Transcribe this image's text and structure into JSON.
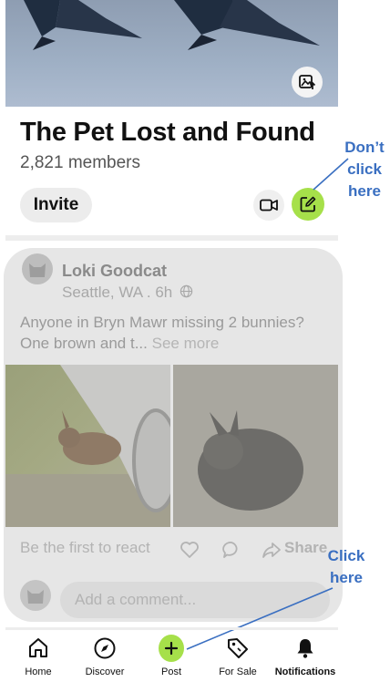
{
  "group": {
    "name": "The Pet Lost and Found",
    "members": "2,821 members",
    "invite_label": "Invite"
  },
  "annotations": {
    "dont_click": [
      "Don’t",
      "click",
      "here"
    ],
    "click": [
      "Click",
      "here"
    ]
  },
  "post": {
    "author": "Loki Goodcat",
    "location_time": "Seattle, WA . 6h",
    "text": "Anyone in Bryn Mawr missing 2 bunnies? One brown and t...",
    "see_more": "See more",
    "react_prompt": "Be the first to react",
    "share_label": "Share",
    "comment_placeholder": "Add a comment..."
  },
  "nav": {
    "items": [
      {
        "label": "Home",
        "icon": "home-icon"
      },
      {
        "label": "Discover",
        "icon": "compass-icon"
      },
      {
        "label": "Post",
        "icon": "plus-icon"
      },
      {
        "label": "For Sale",
        "icon": "tag-icon"
      },
      {
        "label": "Notifications",
        "icon": "bell-icon"
      }
    ]
  },
  "colors": {
    "accent_green": "#a6e04a",
    "annotation_blue": "#3a6fc1",
    "card_dim": "#e6e6e6"
  }
}
